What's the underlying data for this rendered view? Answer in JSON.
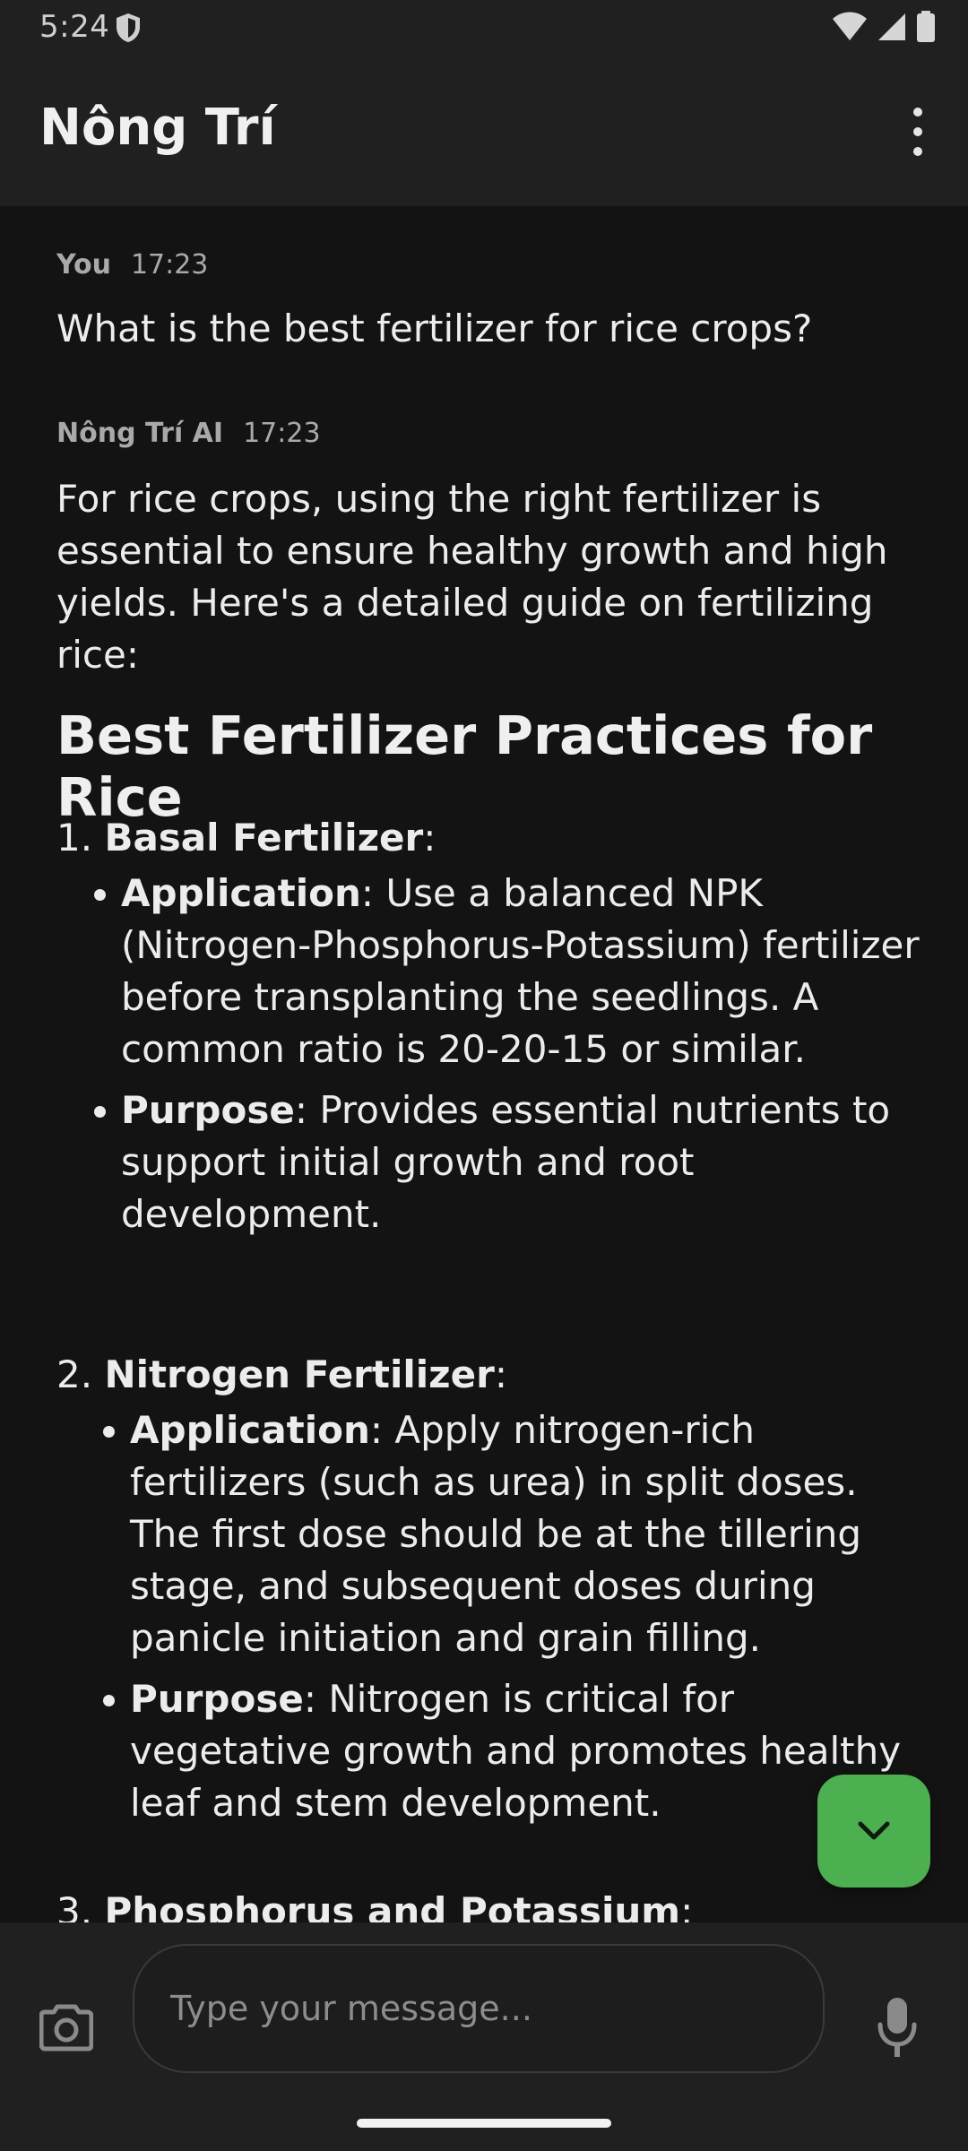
{
  "status_bar": {
    "time": "5:24"
  },
  "app_bar": {
    "title": "Nông Trí"
  },
  "messages": [
    {
      "sender": "You",
      "time": "17:23",
      "text": "What is the best fertilizer for rice crops?"
    },
    {
      "sender": "Nông Trí AI",
      "time": "17:23",
      "intro": "For rice crops, using the right fertilizer is essential to ensure healthy growth and high yields. Here's a detailed guide on fertilizing rice:",
      "heading": "Best Fertilizer Practices for Rice"
    }
  ],
  "sections": [
    {
      "num": "1.",
      "title": "Basal Fertilizer",
      "bullets": [
        {
          "label": "Application",
          "text": ": Use a balanced NPK (Nitrogen-Phosphorus-Potassium) fertilizer before transplanting the seedlings. A common ratio is 20-20-15 or similar."
        },
        {
          "label": "Purpose",
          "text": ": Provides essential nutrients to support initial growth and root development."
        }
      ]
    },
    {
      "num": "2.",
      "title": "Nitrogen Fertilizer",
      "bullets": [
        {
          "label": "Application",
          "text": ": Apply nitrogen-rich fertilizers (such as urea) in split doses. The first dose should be at the tillering stage, and subsequent doses during panicle initiation and grain filling."
        },
        {
          "label": "Purpose",
          "text": ": Nitrogen is critical for vegetative growth and promotes healthy leaf and stem development."
        }
      ]
    },
    {
      "num": "3.",
      "title": "Phosphorus and Potassium"
    }
  ],
  "input": {
    "placeholder": "Type your message..."
  },
  "colors": {
    "accent": "#4caf50",
    "background": "#131313",
    "bar": "#202020"
  }
}
